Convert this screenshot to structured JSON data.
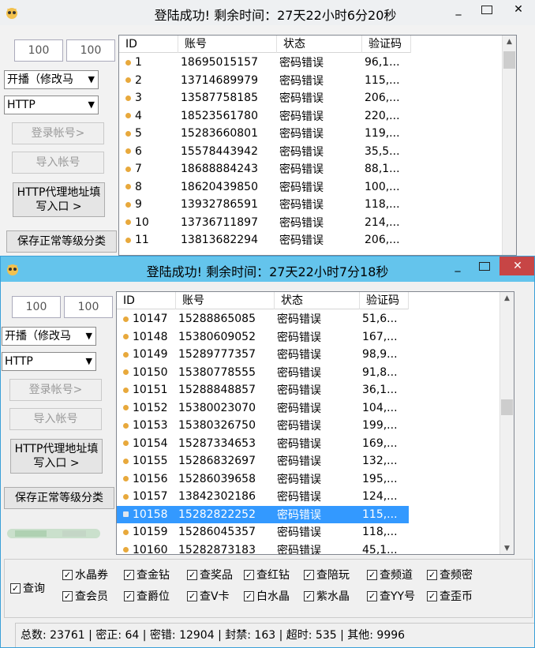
{
  "win1": {
    "title": "登陆成功! 剩余时间：27天22小时6分20秒",
    "inputs": [
      "100",
      "100"
    ],
    "mode_select": "开播（修改马",
    "proxy_select": "HTTP",
    "btn_login": "登录帐号>",
    "btn_import": "导入帐号",
    "btn_proxy": "HTTP代理地址填写入口 >",
    "btn_save": "保存正常等级分类",
    "columns": [
      "ID",
      "账号",
      "状态",
      "验证码"
    ],
    "rows": [
      {
        "id": "1",
        "account": "18695015157",
        "status": "密码错误",
        "code": "96,1..."
      },
      {
        "id": "2",
        "account": "13714689979",
        "status": "密码错误",
        "code": "115,..."
      },
      {
        "id": "3",
        "account": "13587758185",
        "status": "密码错误",
        "code": "206,..."
      },
      {
        "id": "4",
        "account": "18523561780",
        "status": "密码错误",
        "code": "220,..."
      },
      {
        "id": "5",
        "account": "15283660801",
        "status": "密码错误",
        "code": "119,..."
      },
      {
        "id": "6",
        "account": "15578443942",
        "status": "密码错误",
        "code": "35,5..."
      },
      {
        "id": "7",
        "account": "18688884243",
        "status": "密码错误",
        "code": "88,1..."
      },
      {
        "id": "8",
        "account": "18620439850",
        "status": "密码错误",
        "code": "100,..."
      },
      {
        "id": "9",
        "account": "13932786591",
        "status": "密码错误",
        "code": "118,..."
      },
      {
        "id": "10",
        "account": "13736711897",
        "status": "密码错误",
        "code": "214,..."
      },
      {
        "id": "11",
        "account": "13813682294",
        "status": "密码错误",
        "code": "206,..."
      }
    ]
  },
  "win2": {
    "title": "登陆成功! 剩余时间：27天22小时7分18秒",
    "inputs": [
      "100",
      "100"
    ],
    "mode_select": "开播（修改马",
    "proxy_select": "HTTP",
    "btn_login": "登录帐号>",
    "btn_import": "导入帐号",
    "btn_proxy": "HTTP代理地址填写入口 >",
    "btn_save": "保存正常等级分类",
    "columns": [
      "ID",
      "账号",
      "状态",
      "验证码"
    ],
    "rows": [
      {
        "id": "10147",
        "account": "15288865085",
        "status": "密码错误",
        "code": "51,6..."
      },
      {
        "id": "10148",
        "account": "15380609052",
        "status": "密码错误",
        "code": "167,..."
      },
      {
        "id": "10149",
        "account": "15289777357",
        "status": "密码错误",
        "code": "98,9..."
      },
      {
        "id": "10150",
        "account": "15380778555",
        "status": "密码错误",
        "code": "91,8..."
      },
      {
        "id": "10151",
        "account": "15288848857",
        "status": "密码错误",
        "code": "36,1..."
      },
      {
        "id": "10152",
        "account": "15380023070",
        "status": "密码错误",
        "code": "104,..."
      },
      {
        "id": "10153",
        "account": "15380326750",
        "status": "密码错误",
        "code": "199,..."
      },
      {
        "id": "10154",
        "account": "15287334653",
        "status": "密码错误",
        "code": "169,..."
      },
      {
        "id": "10155",
        "account": "15286832697",
        "status": "密码错误",
        "code": "132,..."
      },
      {
        "id": "10156",
        "account": "15286039658",
        "status": "密码错误",
        "code": "195,..."
      },
      {
        "id": "10157",
        "account": "13842302186",
        "status": "密码错误",
        "code": "124,..."
      },
      {
        "id": "10158",
        "account": "15282822252",
        "status": "密码错误",
        "code": "115,...",
        "selected": true
      },
      {
        "id": "10159",
        "account": "15286045357",
        "status": "密码错误",
        "code": "118,..."
      },
      {
        "id": "10160",
        "account": "15282873183",
        "status": "密码错误",
        "code": "45,1..."
      }
    ],
    "check_query": "查询",
    "checks_row1": [
      "水晶券",
      "查金钻",
      "查奖品",
      "查红钻",
      "查陪玩",
      "查频道",
      "查频密"
    ],
    "checks_row2": [
      "查会员",
      "查爵位",
      "查V卡",
      "白水晶",
      "紫水晶",
      "查YY号",
      "查歪币"
    ],
    "status_bar": "总数: 23761  |  密正: 64  |  密错: 12904  |  封禁: 163  |  超时: 535  |  其他: 9996"
  },
  "colors": {
    "titlebar_active": "#64c4ec",
    "close_red": "#c74545",
    "selection": "#3399ff",
    "dot": "#e8a93c"
  }
}
